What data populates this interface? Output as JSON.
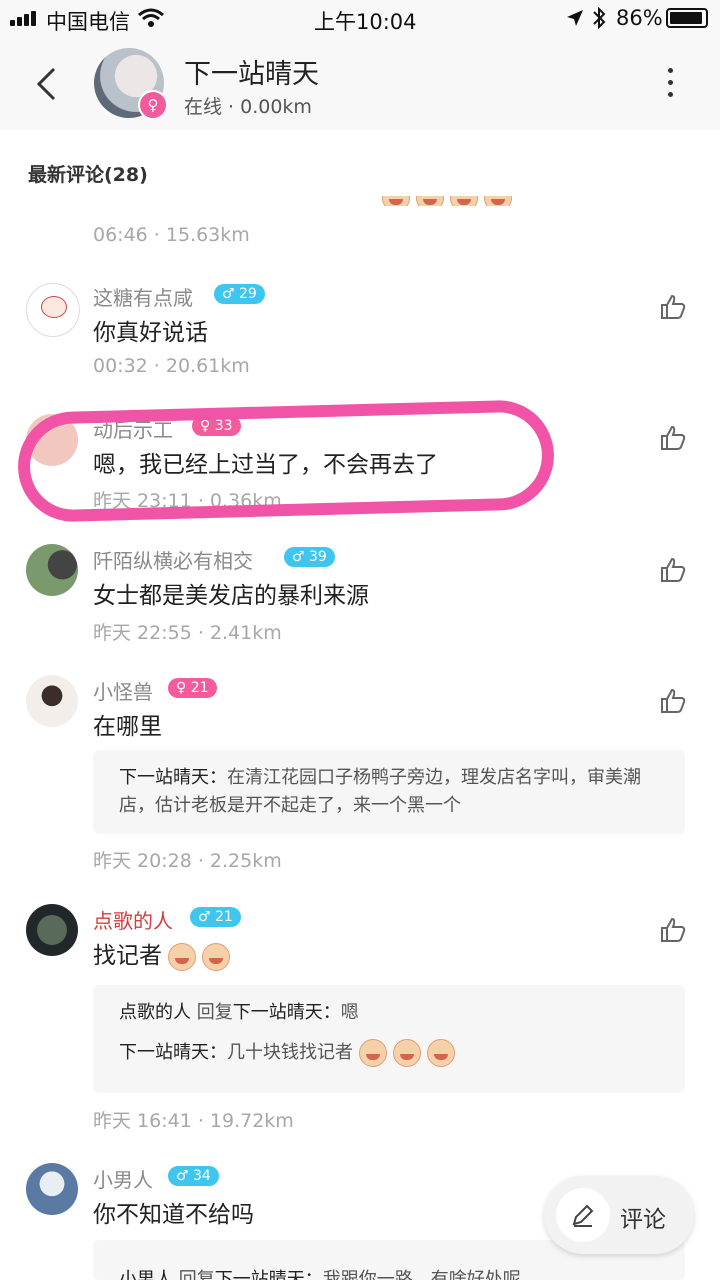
{
  "status_bar": {
    "carrier": "中国电信",
    "time": "上午10:04",
    "battery": "86%"
  },
  "header": {
    "title": "下一站晴天",
    "subtitle": "在线 · 0.00km",
    "back_icon": "chevron-left-icon",
    "more_icon": "more-vertical-icon"
  },
  "section": {
    "title": "最新评论(28)"
  },
  "comments": [
    {
      "meta": "06:46 · 15.63km"
    },
    {
      "name": "这糖有点咸",
      "badge": "♂ 29",
      "content": "你真好说话",
      "meta": "00:32 · 20.61km"
    },
    {
      "name": "动后示工",
      "badge": "♀ 33",
      "content": "嗯，我已经上过当了，不会再去了",
      "meta": "昨天 23:11 · 0.36km"
    },
    {
      "name": "阡陌纵横必有相交",
      "badge": "♂ 39",
      "content": "女士都是美发店的暴利来源",
      "meta": "昨天 22:55 · 2.41km"
    },
    {
      "name": "小怪兽",
      "badge": "♀ 21",
      "content": "在哪里",
      "reply_name": "下一站晴天：",
      "reply_text": "在清江花园口子杨鸭子旁边，理发店名字叫，审美潮店，估计老板是开不起走了，来一个黑一个",
      "meta": "昨天 20:28 · 2.25km"
    },
    {
      "name": "点歌的人",
      "badge": "♂ 21",
      "content": "找记者",
      "reply1_a": "点歌的人",
      "reply1_mid": " 回复",
      "reply1_b": "下一站晴天：",
      "reply1_text": "嗯",
      "reply2_name": "下一站晴天：",
      "reply2_text": "几十块钱找记者",
      "meta": "昨天 16:41 · 19.72km"
    },
    {
      "name": "小男人",
      "badge": "♂ 34",
      "content": "你不知道不给吗",
      "reply_a": "小男人",
      "reply_mid": " 回复",
      "reply_b": "下一站晴天：",
      "reply_text": "我跟你一路，有啥好处呢"
    }
  ],
  "fab": {
    "label": "评论",
    "icon": "pencil-icon"
  }
}
